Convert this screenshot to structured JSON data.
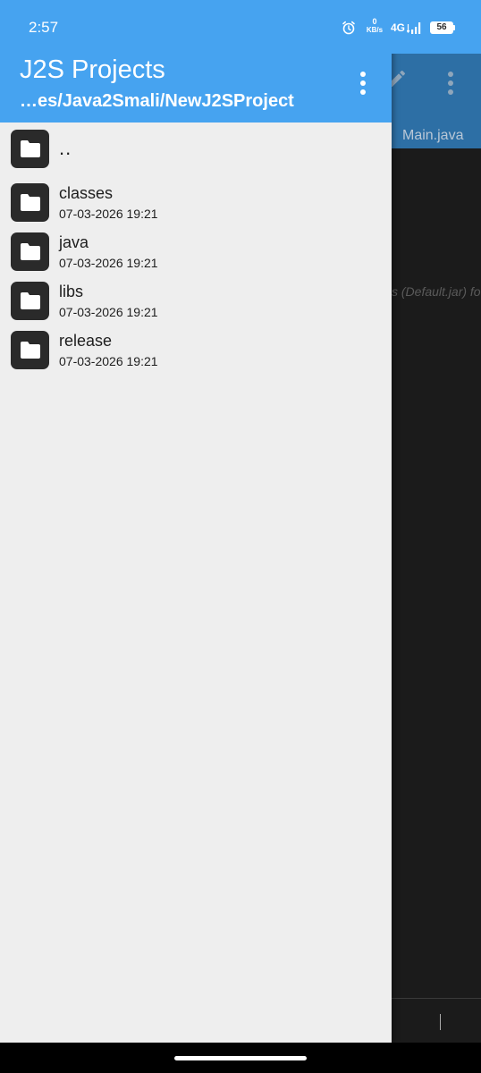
{
  "status_bar": {
    "time": "2:57",
    "net_speed_value": "0",
    "net_speed_unit": "KB/s",
    "network_type": "4G",
    "battery": "56",
    "icons": [
      "alarm-icon",
      "signal-icon",
      "battery-icon"
    ]
  },
  "background_app": {
    "tab_label": "Main.java",
    "hint_text": "s (Default.jar) fo",
    "icons": [
      "pencil-icon",
      "more-vert-icon"
    ]
  },
  "drawer": {
    "title": "J2S Projects",
    "path": "…es/Java2Smali/NewJ2SProject",
    "parent_label": "..",
    "items": [
      {
        "name": "classes",
        "date": "07-03-2026 19:21"
      },
      {
        "name": "java",
        "date": "07-03-2026 19:21"
      },
      {
        "name": "libs",
        "date": "07-03-2026 19:21"
      },
      {
        "name": "release",
        "date": "07-03-2026 19:21"
      }
    ]
  },
  "colors": {
    "header_blue": "#46a3f0",
    "drawer_bg": "#eeeeee",
    "editor_bg": "#1b1b1b",
    "toolbar_dim": "#2d6fa5",
    "folder_tile": "#2a2a2a"
  }
}
